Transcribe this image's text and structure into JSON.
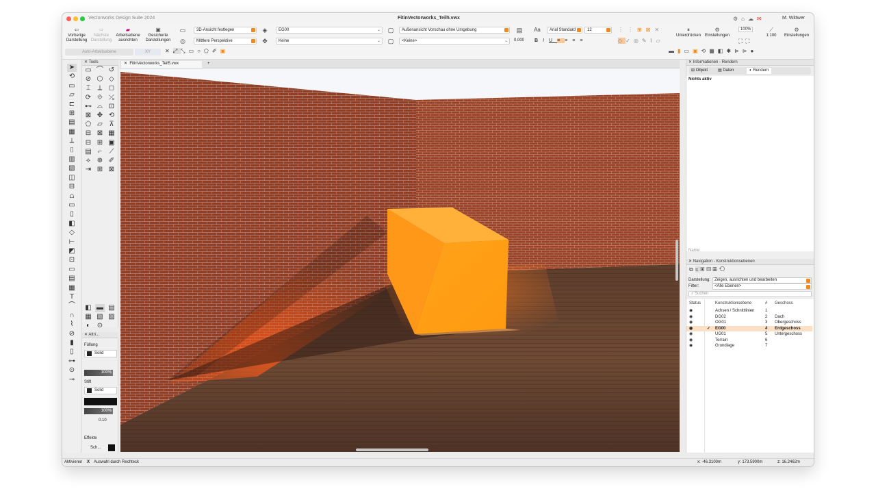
{
  "window": {
    "app_name": "Vectorworks Design Suite 2024",
    "doc_title": "FitinVectorworks_Teil5.vwx",
    "user": "M. Wittwer"
  },
  "toolbar": {
    "prev_view": "Vorherige Darstellung",
    "next_view": "Nächste Darstellung",
    "align_plane": "Arbeitsebene ausrichten",
    "saved_views": "Gesicherte Darstellungen",
    "view_3d": "3D-Ansicht festlegen",
    "projection": "Mittlere Perspektive",
    "layer": "EG00",
    "class": "Keine",
    "render_mode": "Außenansicht Vorschau ohne Umgebung",
    "render_sub": "<Keine>",
    "value": "0.000",
    "font": "Arial Standard",
    "font_size": "12",
    "suppress": "Unterdrücken",
    "settings1": "Einstellungen",
    "zoom": "100%",
    "scale": "1:100",
    "settings2": "Einstellungen",
    "auto_plane": "Auto-Arbeitsebene",
    "plane_mode": "XY"
  },
  "tools_panel": {
    "title": "Tools"
  },
  "attr_panel": {
    "title": "Attri...",
    "fill_label": "Füllung",
    "fill_style": "Solid",
    "fill_opacity": "100%",
    "pen_label": "Stift",
    "pen_style": "Solid",
    "pen_opacity": "100%",
    "thickness": "0.10",
    "effects_label": "Effekte",
    "effects_value": "Sch..."
  },
  "tabs": {
    "doc_tab": "FitinVectorworks_Teil5.vwx",
    "add": "+"
  },
  "info_panel": {
    "title": "Informationen - Rendern",
    "tab_object": "Objekt",
    "tab_data": "Daten",
    "tab_render": "Rendern",
    "status": "Nichts aktiv",
    "name_label": "Name:"
  },
  "nav_panel": {
    "title": "Navigation - Konstruktionsebenen",
    "display_label": "Darstellung:",
    "display_value": "Zeigen, ausrichten und bearbeiten",
    "filter_label": "Filter:",
    "filter_value": "<Alle Ebenen>",
    "search_placeholder": "Suchen",
    "col_status": "Status",
    "col_layer": "Konstruktionsebene",
    "col_num": "#",
    "col_story": "Geschoss",
    "layers": [
      {
        "name": "Achsen / Schnittlinien",
        "num": "1",
        "story": ""
      },
      {
        "name": "DG02",
        "num": "2",
        "story": "Dach"
      },
      {
        "name": "OG01",
        "num": "3",
        "story": "Obergeschoss"
      },
      {
        "name": "EG00",
        "num": "4",
        "story": "Erdgeschoss",
        "active": true
      },
      {
        "name": "UG01",
        "num": "5",
        "story": "Untergeschoss"
      },
      {
        "name": "Terrain",
        "num": "6",
        "story": ""
      },
      {
        "name": "Grundlage",
        "num": "7",
        "story": ""
      }
    ]
  },
  "statusbar": {
    "mode": "Aktivieren",
    "x_mark": "X",
    "hint": "Auswahl durch Rechteck",
    "x": "x: -46.3100m",
    "y": "y: 173.5900m",
    "z": "z: 16.2462m"
  },
  "colors": {
    "accent": "#f08a1e",
    "box": "#ffa11a",
    "brick": "#a94a2c",
    "floor": "#6a4530"
  }
}
